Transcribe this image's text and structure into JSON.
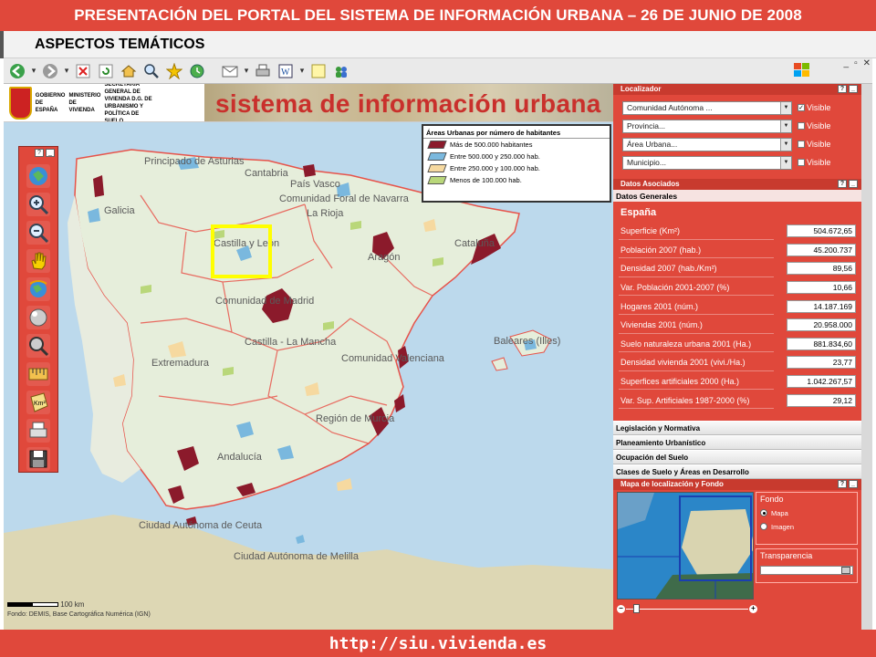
{
  "banner": {
    "title": "PRESENTACIÓN DEL PORTAL DEL SISTEMA DE INFORMACIÓN URBANA – 26 DE JUNIO DE 2008"
  },
  "subtitle": {
    "text": "ASPECTOS TEMÁTICOS"
  },
  "toolbar": {
    "icons": [
      "back-icon",
      "forward-icon",
      "stop-icon",
      "refresh-icon",
      "home-icon",
      "search-icon",
      "favorites-icon",
      "history-icon",
      "mail-icon",
      "print-icon",
      "edit-icon",
      "notes-icon",
      "messenger-icon"
    ]
  },
  "header": {
    "gov_line1": "GOBIERNO DE ESPAÑA",
    "gov_line2": "MINISTERIO DE VIVIENDA",
    "gov_line3": "SECRETARÍA GENERAL DE VIVIENDA D.G. DE URBANISMO Y POLÍTICA DE SUELO",
    "site_title": "sistema de información urbana"
  },
  "legend": {
    "title": "Áreas Urbanas por número de habitantes",
    "items": [
      {
        "label": "Más de 500.000 habitantes",
        "color": "#8b1a2b"
      },
      {
        "label": "Entre 500.000 y 250.000 hab.",
        "color": "#7ab8de"
      },
      {
        "label": "Entre 250.000 y 100.000 hab.",
        "color": "#f6d9a0"
      },
      {
        "label": "Menos de 100.000 hab.",
        "color": "#b9d77a"
      }
    ]
  },
  "map_labels": {
    "asturias": "Principado de Asturias",
    "cantabria": "Cantabria",
    "pais_vasco": "País Vasco",
    "navarra": "Comunidad Foral de Navarra",
    "rioja": "La Rioja",
    "galicia": "Galicia",
    "castilla_leon": "Castilla y León",
    "aragon": "Aragón",
    "cataluna": "Cataluña",
    "madrid": "Comunidad de Madrid",
    "castilla_mancha": "Castilla - La Mancha",
    "baleares": "Baleares (Illes)",
    "extremadura": "Extremadura",
    "valenciana": "Comunidad Valenciana",
    "murcia": "Región de Murcia",
    "andalucia": "Andalucía",
    "ceuta": "Ciudad Autónoma de Ceuta",
    "melilla": "Ciudad Autónoma de Melilla"
  },
  "scale": {
    "label": "100 km",
    "attribution": "Fondo: DEMIS, Base Cartográfica Numérica (IGN)"
  },
  "localizador": {
    "title": "Localizador",
    "selects": [
      {
        "value": "Comunidad Autónoma ...",
        "visible_label": "Visible",
        "checked": true
      },
      {
        "value": "Provincia...",
        "visible_label": "Visible",
        "checked": false
      },
      {
        "value": "Área Urbana...",
        "visible_label": "Visible",
        "checked": false
      },
      {
        "value": "Municipio...",
        "visible_label": "Visible",
        "checked": false
      }
    ]
  },
  "datos": {
    "title": "Datos Asociados",
    "tab": "Datos Generales",
    "region": "España",
    "rows": [
      {
        "label": "Superficie (Km²)",
        "value": "504.672,65"
      },
      {
        "label": "Población 2007 (hab.)",
        "value": "45.200.737"
      },
      {
        "label": "Densidad 2007 (hab./Km²)",
        "value": "89,56"
      },
      {
        "label": "Var. Población 2001-2007 (%)",
        "value": "10,66"
      },
      {
        "label": "Hogares 2001 (núm.)",
        "value": "14.187.169"
      },
      {
        "label": "Viviendas 2001 (núm.)",
        "value": "20.958.000"
      },
      {
        "label": "Suelo naturaleza urbana 2001 (Ha.)",
        "value": "881.834,60"
      },
      {
        "label": "Densidad vivienda 2001 (vivi./Ha.)",
        "value": "23,77"
      },
      {
        "label": "Superfices artificiales 2000 (Ha.)",
        "value": "1.042.267,57"
      },
      {
        "label": "Var. Sup. Artificiales 1987-2000 (%)",
        "value": "29,12"
      }
    ]
  },
  "accordion": [
    "Legislación y Normativa",
    "Planeamiento Urbanístico",
    "Ocupación del Suelo",
    "Clases de Suelo y Áreas en Desarrollo"
  ],
  "minimap": {
    "title": "Mapa de localización y Fondo",
    "fondo_label": "Fondo",
    "options": [
      {
        "label": "Mapa",
        "selected": true
      },
      {
        "label": "Imagen",
        "selected": false
      }
    ],
    "transparencia_label": "Transparencia"
  },
  "footer": {
    "url": "http://siu.vivienda.es"
  }
}
